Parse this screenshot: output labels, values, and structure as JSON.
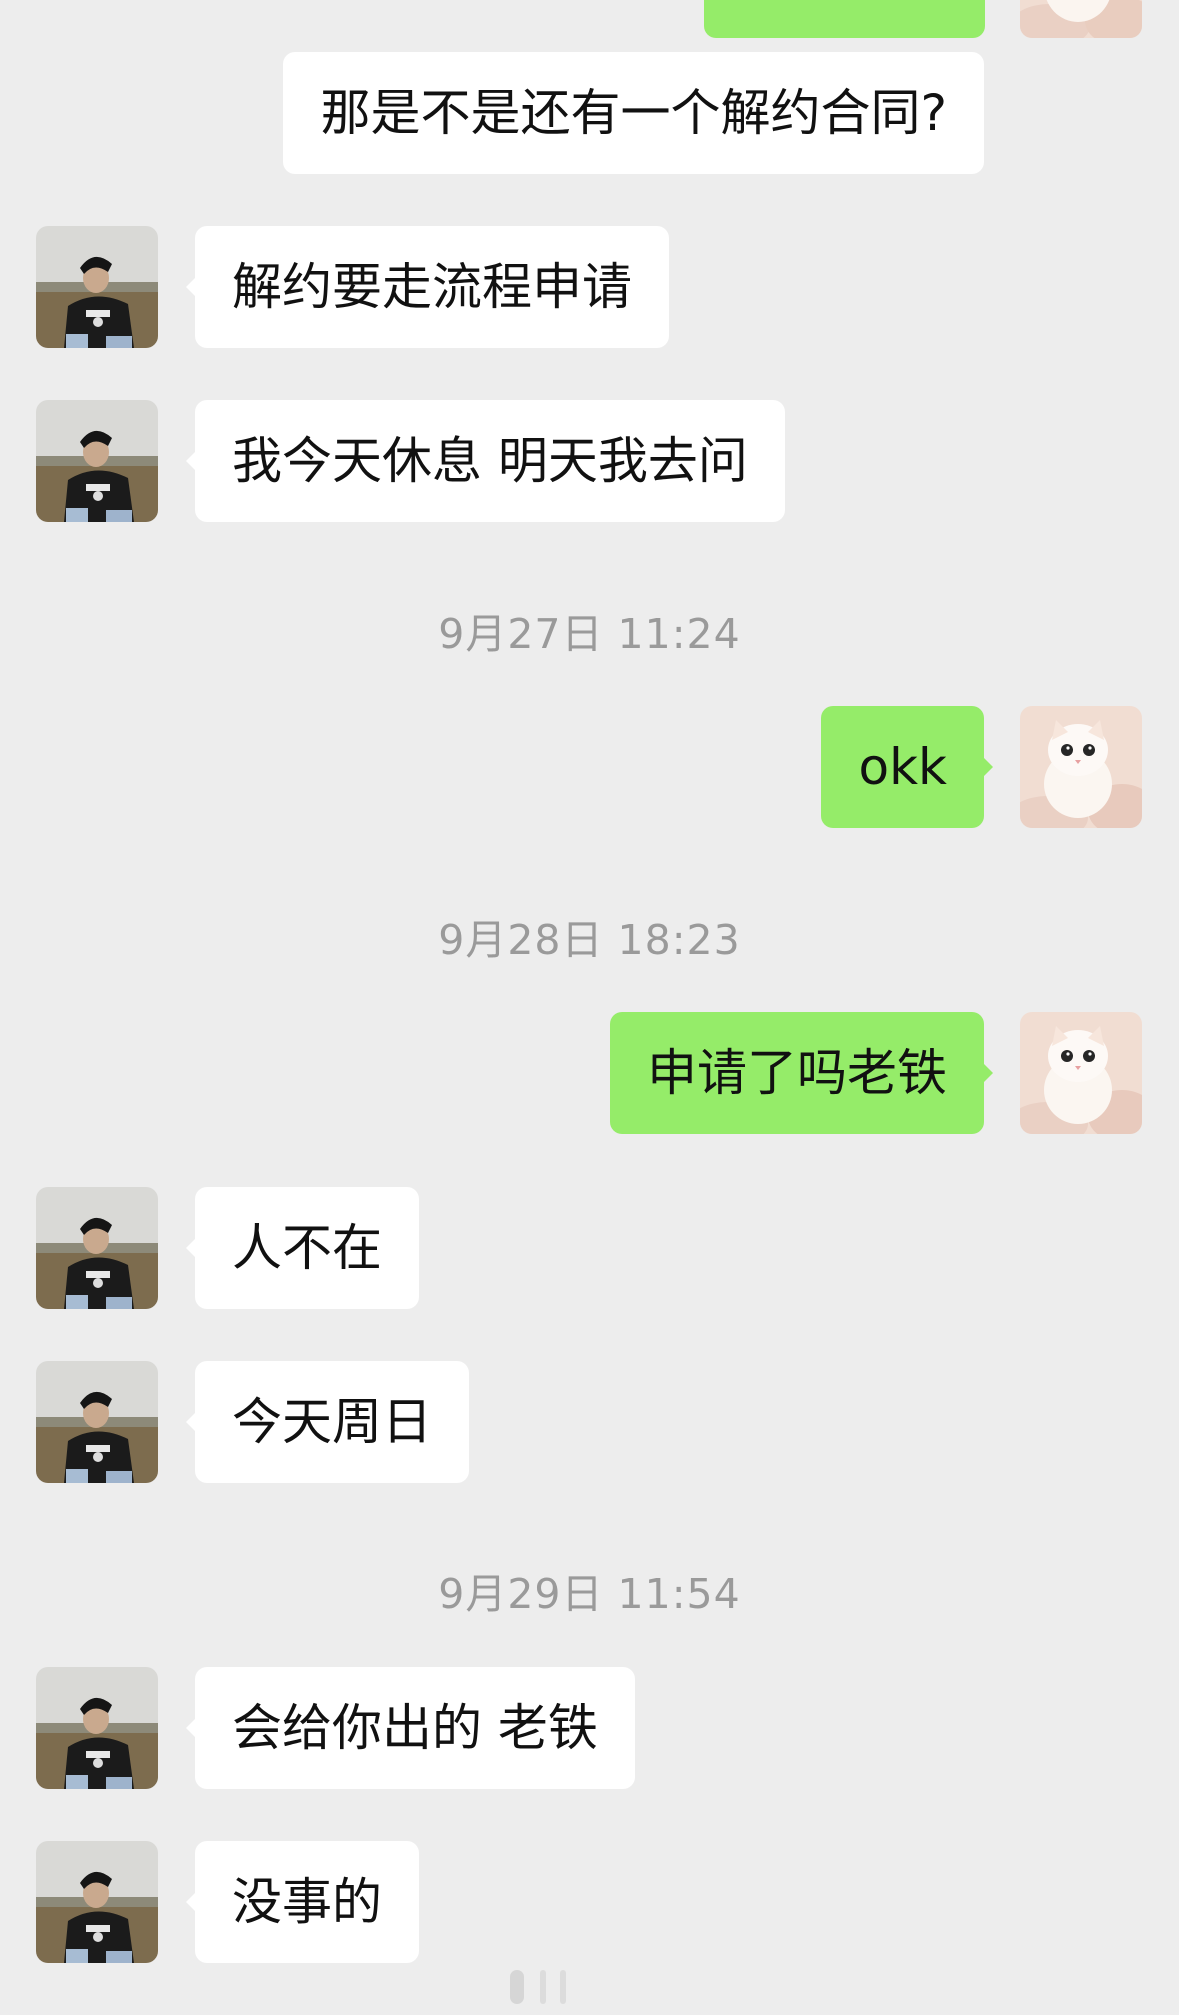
{
  "chat": {
    "partner_avatar_icon": "person-photo-avatar-icon",
    "self_avatar_icon": "white-kitten-avatar-icon",
    "colors": {
      "background": "#ededed",
      "incoming_bubble": "#ffffff",
      "outgoing_bubble": "#95ec69",
      "timestamp_text": "#9a9a9a"
    },
    "messages": [
      {
        "sender": "self",
        "text": "那是不是还有一个解约合同?"
      },
      {
        "sender": "partner",
        "text": "解约要走流程申请"
      },
      {
        "sender": "partner",
        "text": "我今天休息 明天我去问"
      },
      {
        "type": "timestamp",
        "text": "9月27日 11:24"
      },
      {
        "sender": "self",
        "text": "okk"
      },
      {
        "type": "timestamp",
        "text": "9月28日 18:23"
      },
      {
        "sender": "self",
        "text": "申请了吗老铁"
      },
      {
        "sender": "partner",
        "text": "人不在"
      },
      {
        "sender": "partner",
        "text": "今天周日"
      },
      {
        "type": "timestamp",
        "text": "9月29日 11:54"
      },
      {
        "sender": "partner",
        "text": "会给你出的 老铁"
      },
      {
        "sender": "partner",
        "text": "没事的"
      }
    ]
  }
}
